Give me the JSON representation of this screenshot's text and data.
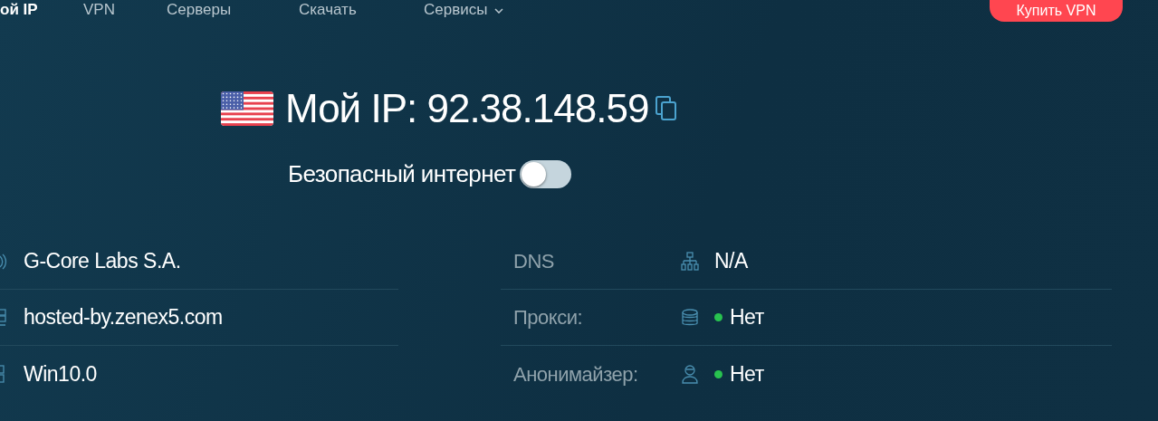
{
  "nav": {
    "items": [
      {
        "label": "ой IP",
        "selected": true
      },
      {
        "label": "VPN",
        "selected": false
      },
      {
        "label": "Серверы",
        "selected": false
      },
      {
        "label": "Скачать",
        "selected": false
      },
      {
        "label": "Сервисы",
        "selected": false,
        "dropdown": true
      }
    ],
    "buy_button": "Купить VPN"
  },
  "ip": {
    "label": "Мой IP:",
    "value": "92.38.148.59"
  },
  "safe_internet": {
    "label": "Безопасный интернет",
    "on": false
  },
  "left_rows": [
    {
      "value": "G-Core Labs S.A."
    },
    {
      "value": "hosted-by.zenex5.com"
    },
    {
      "value": "Win10.0"
    }
  ],
  "right_rows": [
    {
      "label": "DNS",
      "value": "N/A"
    },
    {
      "label": "Прокси:",
      "value": "Нет",
      "color": "#28c24f"
    },
    {
      "label": "Анонимайзер:",
      "value": "Нет",
      "color": "#28c24f"
    }
  ]
}
